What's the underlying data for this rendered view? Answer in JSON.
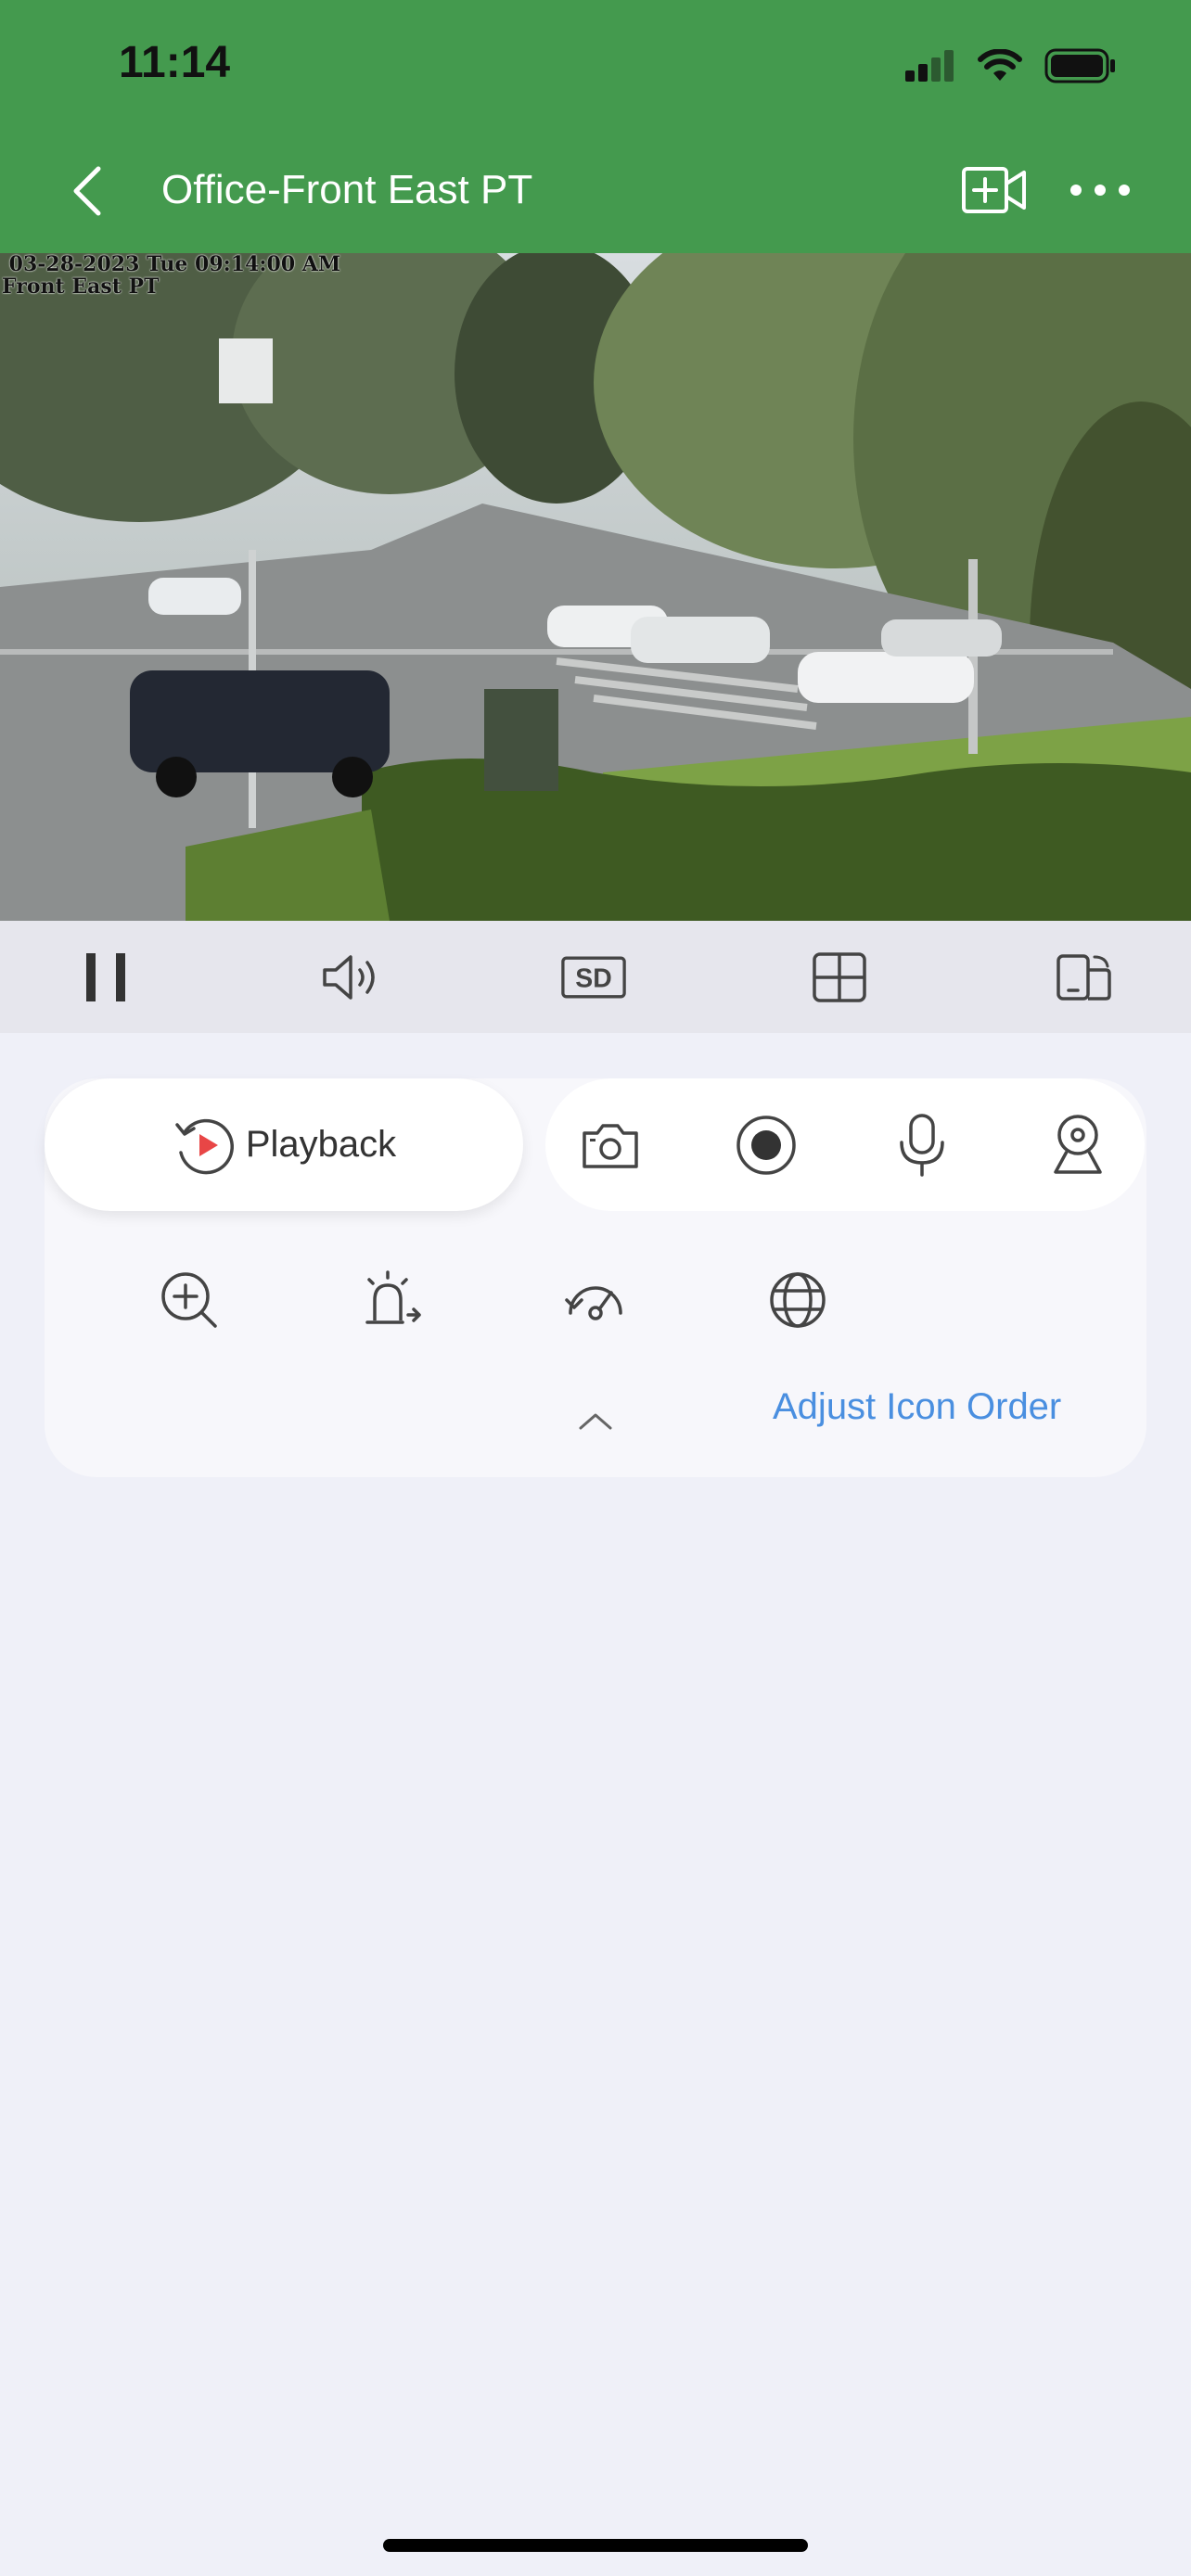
{
  "status_bar": {
    "time": "11:14"
  },
  "nav": {
    "title": "Office-Front East PT",
    "back_icon": "chevron-left-icon",
    "add_icon": "add-video-icon",
    "more_icon": "more-horizontal-icon"
  },
  "video": {
    "osd_line1": " 03-28-2023 Tue 09:14:00 AM",
    "osd_line2": "Front East PT"
  },
  "controls": [
    "pause-icon",
    "speaker-icon",
    "sd-quality-icon",
    "grid-split-icon",
    "rotate-screen-icon"
  ],
  "controls_sd_label": "SD",
  "panel": {
    "playback_label": "Playback",
    "tools_top": [
      "camera-snapshot-icon",
      "record-icon",
      "microphone-icon",
      "ptz-icon"
    ],
    "tools_bottom": [
      "zoom-in-icon",
      "alarm-icon",
      "speed-dome-icon",
      "globe-icon"
    ],
    "adjust_link": "Adjust Icon Order"
  },
  "colors": {
    "header_green": "#449a4e",
    "link_blue": "#4a8fe0",
    "panel_bg": "#eff0f8"
  }
}
